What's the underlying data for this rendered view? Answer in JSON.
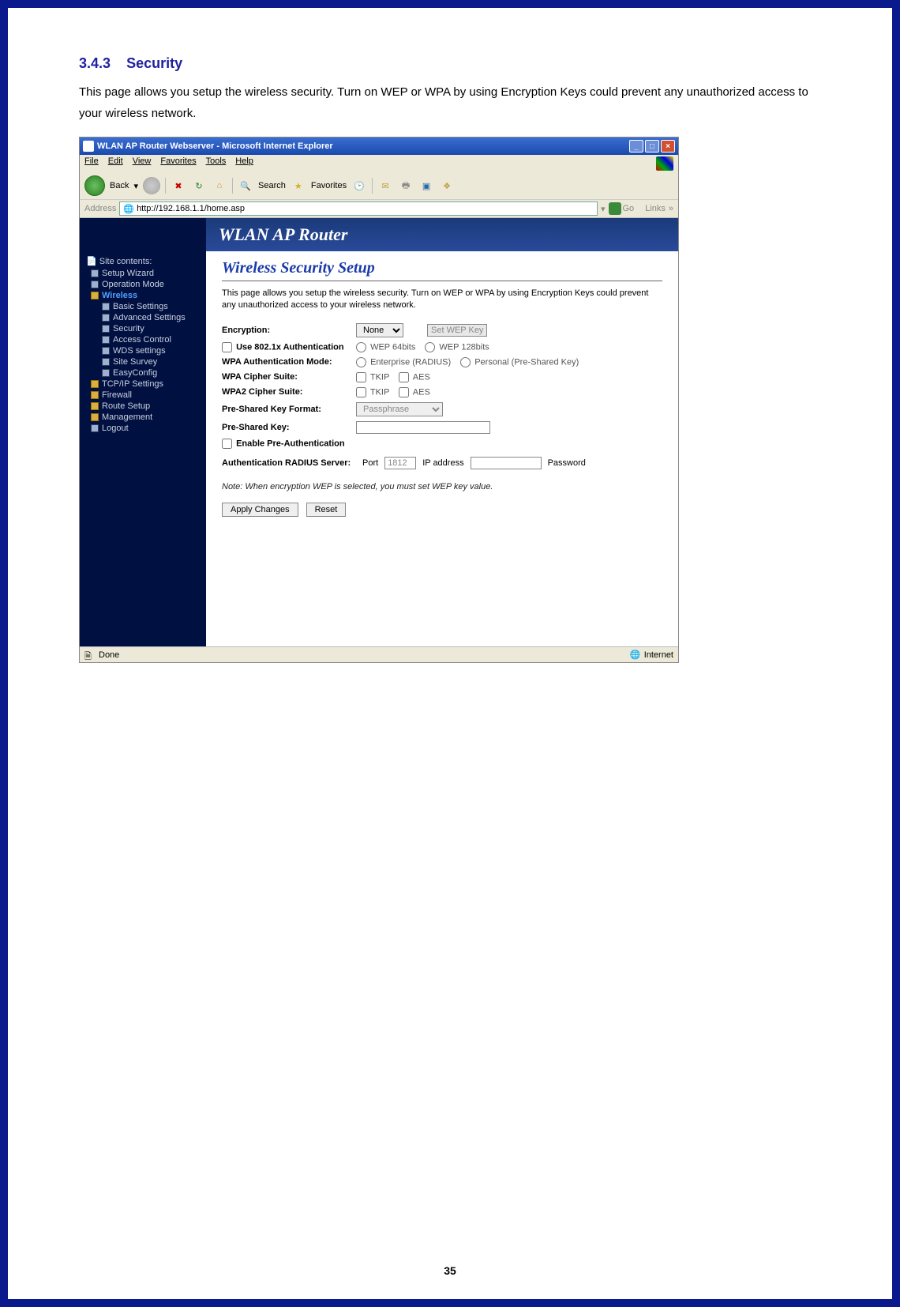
{
  "doc": {
    "heading_num": "3.4.3",
    "heading_title": "Security",
    "body": "This page allows you setup the wireless security. Turn on WEP or WPA by using Encryption Keys could prevent any unauthorized access to your wireless network.",
    "page_number": "35"
  },
  "window": {
    "title": "WLAN AP Router Webserver - Microsoft Internet Explorer"
  },
  "menu": {
    "file": "File",
    "edit": "Edit",
    "view": "View",
    "favorites": "Favorites",
    "tools": "Tools",
    "help": "Help"
  },
  "toolbar": {
    "back": "Back",
    "search": "Search",
    "favorites": "Favorites"
  },
  "address": {
    "label": "Address",
    "url": "http://192.168.1.1/home.asp",
    "go": "Go",
    "links": "Links"
  },
  "router_header": "WLAN AP Router",
  "sidebar": {
    "title": "Site contents:",
    "setup_wizard": "Setup Wizard",
    "operation_mode": "Operation Mode",
    "wireless": "Wireless",
    "basic_settings": "Basic Settings",
    "advanced_settings": "Advanced Settings",
    "security": "Security",
    "access_control": "Access Control",
    "wds": "WDS settings",
    "site_survey": "Site Survey",
    "easyconfig": "EasyConfig",
    "tcpip": "TCP/IP Settings",
    "firewall": "Firewall",
    "route_setup": "Route Setup",
    "management": "Management",
    "logout": "Logout"
  },
  "panel": {
    "heading": "Wireless Security Setup",
    "desc": "This page allows you setup the wireless security. Turn on WEP or WPA by using Encryption Keys could prevent any unauthorized access to your wireless network.",
    "encryption_label": "Encryption:",
    "encryption_value": "None",
    "set_wep_btn": "Set WEP Key",
    "use_8021x": "Use 802.1x Authentication",
    "wep64": "WEP 64bits",
    "wep128": "WEP 128bits",
    "wpa_auth_mode": "WPA Authentication Mode:",
    "enterprise": "Enterprise (RADIUS)",
    "personal": "Personal (Pre-Shared Key)",
    "wpa_cipher": "WPA Cipher Suite:",
    "wpa2_cipher": "WPA2 Cipher Suite:",
    "tkip": "TKIP",
    "aes": "AES",
    "psk_format": "Pre-Shared Key Format:",
    "passphrase": "Passphrase",
    "psk": "Pre-Shared Key:",
    "enable_preauth": "Enable Pre-Authentication",
    "radius_label": "Authentication RADIUS Server:",
    "port_label": "Port",
    "port_value": "1812",
    "ip_label": "IP address",
    "password_label": "Password",
    "note": "Note: When encryption WEP is selected, you must set WEP key value.",
    "apply": "Apply Changes",
    "reset": "Reset"
  },
  "status": {
    "done": "Done",
    "internet": "Internet"
  }
}
